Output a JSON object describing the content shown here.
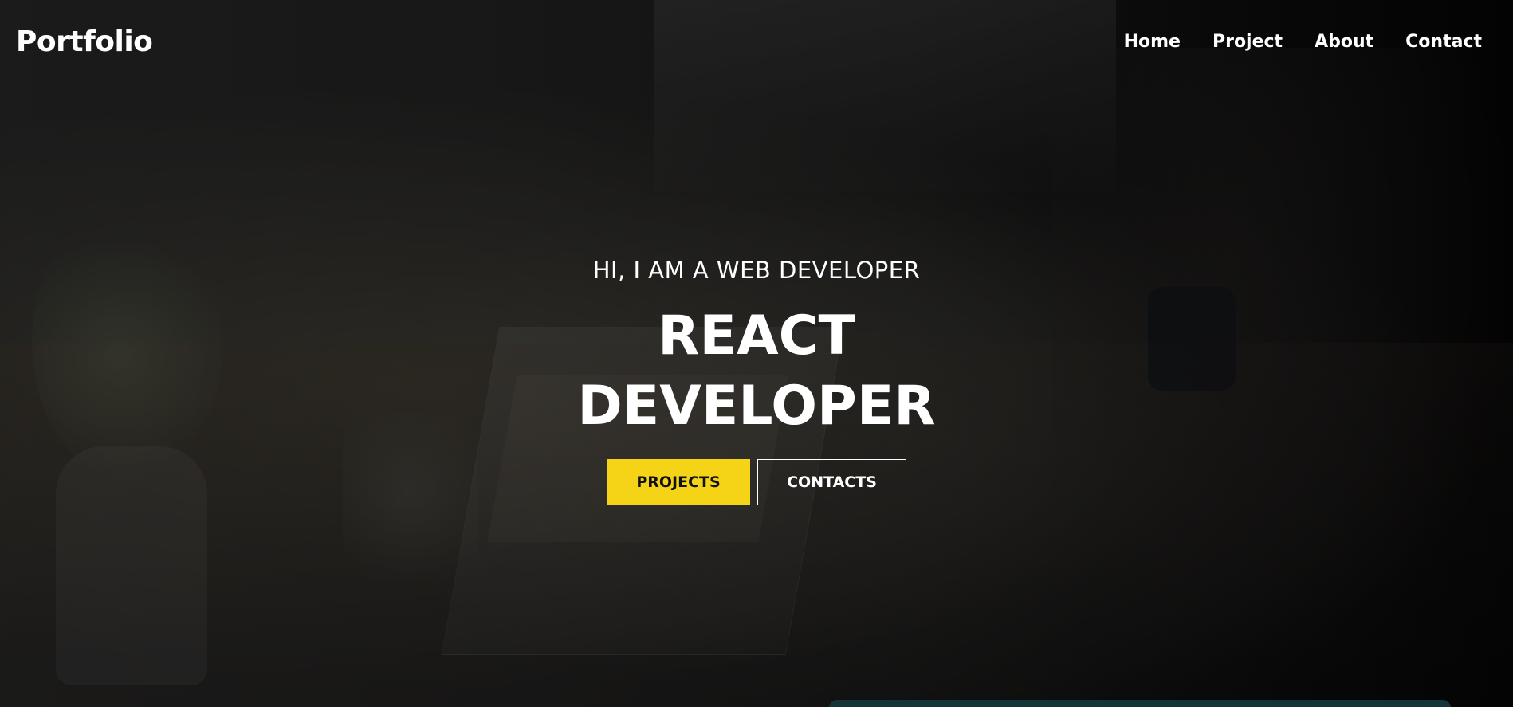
{
  "header": {
    "logo": "Portfolio",
    "nav": [
      {
        "label": "Home"
      },
      {
        "label": "Project"
      },
      {
        "label": "About"
      },
      {
        "label": "Contact"
      }
    ]
  },
  "hero": {
    "subtitle": "HI, I AM A WEB DEVELOPER",
    "title_line1": "REACT",
    "title_line2": "DEVELOPER",
    "primary_button": "PROJECTS",
    "secondary_button": "CONTACTS"
  },
  "colors": {
    "accent": "#f5d316",
    "text": "#ffffff",
    "background": "#0b0b0d"
  }
}
